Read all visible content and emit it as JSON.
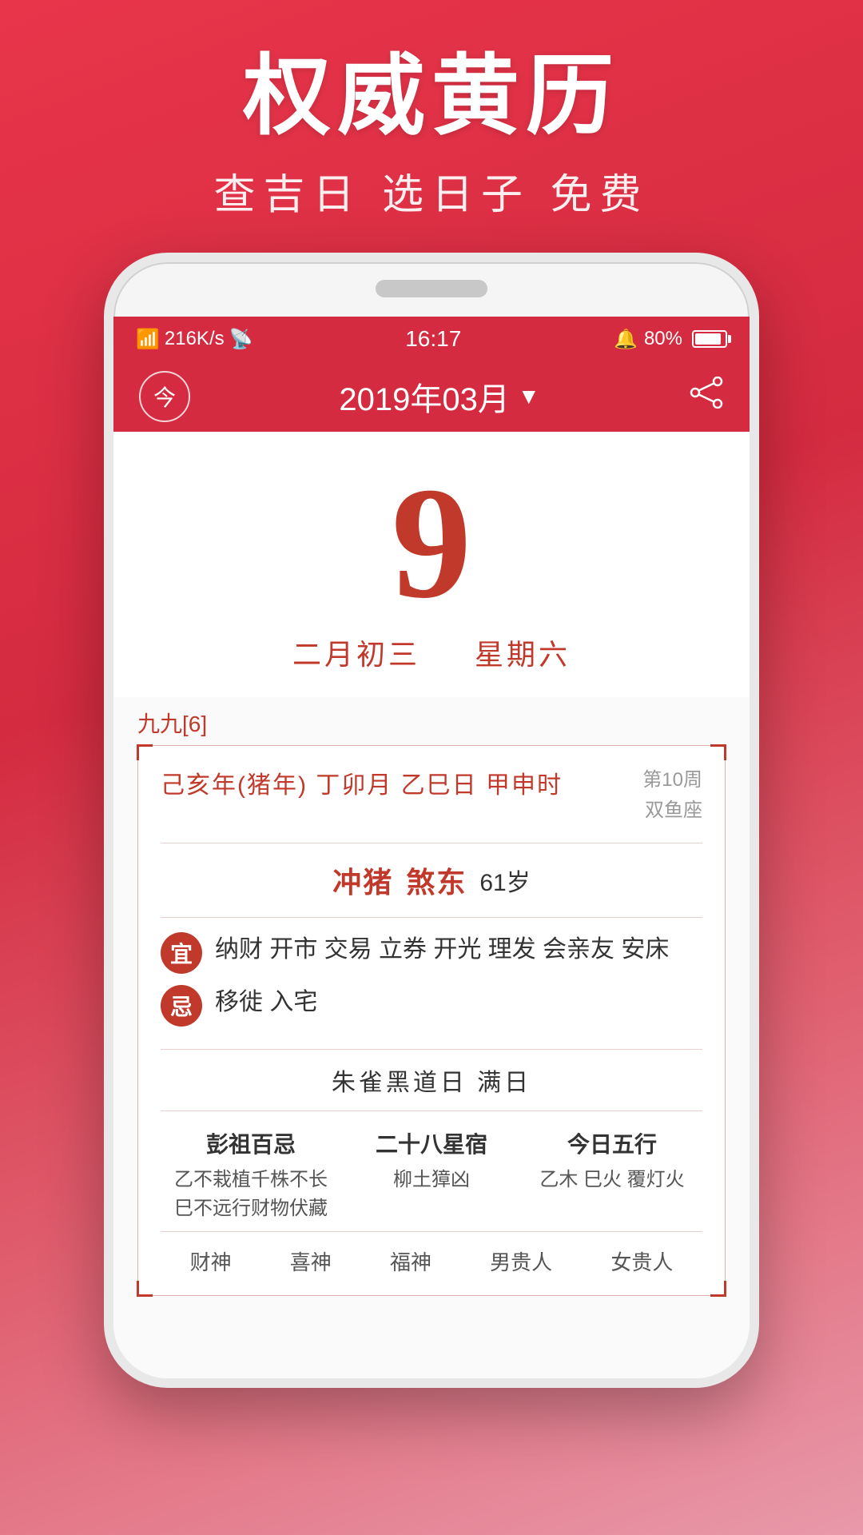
{
  "background": {
    "gradient_start": "#e8354a",
    "gradient_end": "#e899aa"
  },
  "top_section": {
    "main_title": "权威黄历",
    "sub_title": "查吉日 选日子 免费"
  },
  "status_bar": {
    "signal": "4G",
    "data_speed": "216K/s",
    "wifi": "WiFi",
    "time": "16:17",
    "alarm": "🔔",
    "battery_percent": "80%"
  },
  "app_header": {
    "today_button_label": "今",
    "month_display": "2019年03月",
    "dropdown_arrow": "▼",
    "share_icon": "share"
  },
  "date_display": {
    "day_number": "9",
    "lunar": "二月初三",
    "weekday": "星期六"
  },
  "almanac": {
    "nine_nine_label": "九九[6]",
    "ganzhi": "己亥年(猪年) 丁卯月 乙巳日 甲申时",
    "week_number": "第10周",
    "zodiac": "双鱼座",
    "chong": "冲猪",
    "sha": "煞东",
    "age": "61岁",
    "yi_badge": "宜",
    "yi_content": "纳财 开市 交易 立券 开光 理发 会亲友 安床",
    "ji_badge": "忌",
    "ji_content": "移徙 入宅",
    "black_day": "朱雀黑道日  满日",
    "col1_title": "彭祖百忌",
    "col1_line1": "乙不栽植千株不长",
    "col1_line2": "巳不远行财物伏藏",
    "col2_title": "二十八星宿",
    "col2_content": "柳土獐凶",
    "col3_title": "今日五行",
    "col3_content": "乙木 巳火 覆灯火",
    "gods": [
      "财神",
      "喜神",
      "福神",
      "男贵人",
      "女贵人"
    ]
  }
}
